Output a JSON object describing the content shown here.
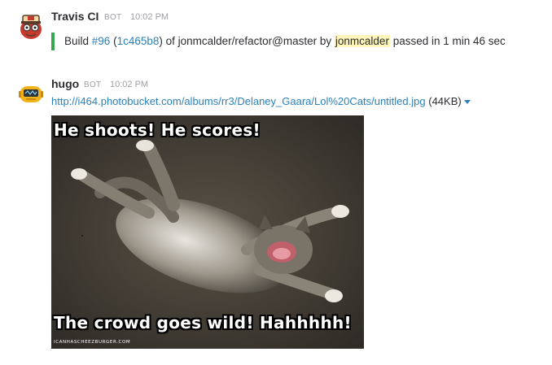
{
  "messages": [
    {
      "sender": "Travis CI",
      "bot_label": "BOT",
      "time": "10:02 PM",
      "avatar_icon": "travis-ci-mascot-icon",
      "attachment": {
        "border_color": "#36a64f",
        "prefix": "Build ",
        "build_link": "#96",
        "open_paren": " (",
        "commit_link": "1c465b8",
        "middle": ") of jonmcalder/refactor@master by ",
        "mention": "jonmcalder",
        "suffix": " passed in 1 min 46 sec"
      }
    },
    {
      "sender": "hugo",
      "bot_label": "BOT",
      "time": "10:02 PM",
      "avatar_icon": "hugo-robot-icon",
      "url": "http://i464.photobucket.com/albums/rr3/Delaney_Gaara/Lol%20Cats/untitled.jpg",
      "size": "(44KB)",
      "dropdown_icon": "caret-down-icon",
      "image": {
        "top_caption": "He shoots! He scores!",
        "bottom_caption": "The crowd goes wild! Hahhhhh!",
        "watermark": "ICANHASCHEEZBURGER.COM"
      }
    }
  ],
  "colors": {
    "link": "#2a80b9",
    "mention_bg": "#fff5b8",
    "muted": "#9e9ea6"
  }
}
